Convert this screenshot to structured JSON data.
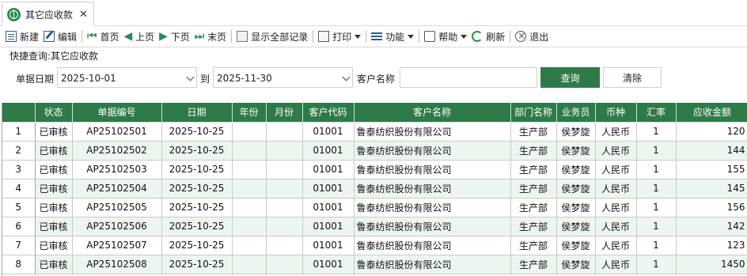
{
  "tab": {
    "title": "其它应收款",
    "close": "✕"
  },
  "toolbar": {
    "new": "新建",
    "edit": "编辑",
    "first": "首页",
    "prev": "上页",
    "next": "下页",
    "last": "末页",
    "show_all": "显示全部记录",
    "print": "打印",
    "function": "功能",
    "help": "帮助",
    "refresh": "刷新",
    "exit": "退出"
  },
  "query": {
    "title": "快捷查询:其它应收款",
    "date_label": "单据日期",
    "date_from": "2025-10-01",
    "to_label": "到",
    "date_to": "2025-11-30",
    "customer_label": "客户名称",
    "customer_value": "",
    "search_button": "查询",
    "clear_button": "清除"
  },
  "table": {
    "columns": [
      "状态",
      "单据编号",
      "日期",
      "年份",
      "月份",
      "客户代码",
      "客户名称",
      "部门名称",
      "业务员",
      "币种",
      "汇率",
      "应收金额"
    ],
    "rows": [
      {
        "rownum": "1",
        "status": "已审核",
        "doc_no": "AP25102501",
        "date": "2025-10-25",
        "year": "",
        "month": "",
        "cust_code": "01001",
        "cust_name": "鲁泰纺织股份有限公司",
        "dept": "生产部",
        "salesman": "侯梦旋",
        "currency": "人民币",
        "rate": "1",
        "amount": "120"
      },
      {
        "rownum": "2",
        "status": "已审核",
        "doc_no": "AP25102502",
        "date": "2025-10-25",
        "year": "",
        "month": "",
        "cust_code": "01001",
        "cust_name": "鲁泰纺织股份有限公司",
        "dept": "生产部",
        "salesman": "侯梦旋",
        "currency": "人民币",
        "rate": "1",
        "amount": "144"
      },
      {
        "rownum": "3",
        "status": "已审核",
        "doc_no": "AP25102503",
        "date": "2025-10-25",
        "year": "",
        "month": "",
        "cust_code": "01001",
        "cust_name": "鲁泰纺织股份有限公司",
        "dept": "生产部",
        "salesman": "侯梦旋",
        "currency": "人民币",
        "rate": "1",
        "amount": "155"
      },
      {
        "rownum": "4",
        "status": "已审核",
        "doc_no": "AP25102504",
        "date": "2025-10-25",
        "year": "",
        "month": "",
        "cust_code": "01001",
        "cust_name": "鲁泰纺织股份有限公司",
        "dept": "生产部",
        "salesman": "侯梦旋",
        "currency": "人民币",
        "rate": "1",
        "amount": "145"
      },
      {
        "rownum": "5",
        "status": "已审核",
        "doc_no": "AP25102505",
        "date": "2025-10-25",
        "year": "",
        "month": "",
        "cust_code": "01001",
        "cust_name": "鲁泰纺织股份有限公司",
        "dept": "生产部",
        "salesman": "侯梦旋",
        "currency": "人民币",
        "rate": "1",
        "amount": "156"
      },
      {
        "rownum": "6",
        "status": "已审核",
        "doc_no": "AP25102506",
        "date": "2025-10-25",
        "year": "",
        "month": "",
        "cust_code": "01001",
        "cust_name": "鲁泰纺织股份有限公司",
        "dept": "生产部",
        "salesman": "侯梦旋",
        "currency": "人民币",
        "rate": "1",
        "amount": "142"
      },
      {
        "rownum": "7",
        "status": "已审核",
        "doc_no": "AP25102507",
        "date": "2025-10-25",
        "year": "",
        "month": "",
        "cust_code": "01001",
        "cust_name": "鲁泰纺织股份有限公司",
        "dept": "生产部",
        "salesman": "侯梦旋",
        "currency": "人民币",
        "rate": "1",
        "amount": "123"
      },
      {
        "rownum": "8",
        "status": "已审核",
        "doc_no": "AP25102508",
        "date": "2025-10-25",
        "year": "",
        "month": "",
        "cust_code": "01001",
        "cust_name": "鲁泰纺织股份有限公司",
        "dept": "生产部",
        "salesman": "侯梦旋",
        "currency": "人民币",
        "rate": "1",
        "amount": "1450"
      }
    ]
  },
  "colors": {
    "accent": "#2e7a48",
    "row_alt": "#edf6ee"
  }
}
